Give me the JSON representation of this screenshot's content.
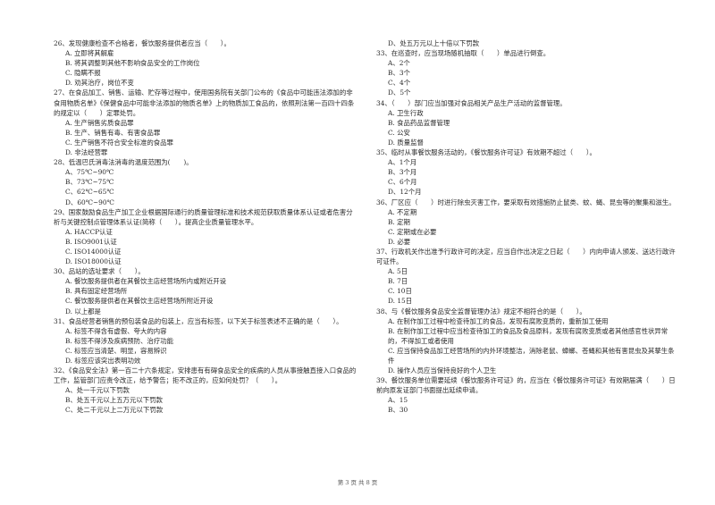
{
  "page": {
    "footer": "第 3 页 共 8 页"
  },
  "left_column": [
    {
      "stem": "26、发现健康检查不合格者，餐饮服务提供者应当（　　）。",
      "options": [
        "A. 立即将其解雇",
        "B. 将其调整到其他不影响食品安全的工作岗位",
        "C. 隐瞒不报",
        "D. 劝其治疗，岗位不变"
      ]
    },
    {
      "stem": "27、在食品加工、销售、运输、贮存等过程中，使用国务院有关部门公布的《食品中可能违法添加的非食用物质名单》《保健食品中可能非法添加的物质名单》上的物质加工食品的，依照刑法第一百四十四条的规定以（　　）定罪处罚。",
      "options": [
        "A. 生产销售劣质食品罪",
        "B. 生产、销售有毒、有害食品罪",
        "C. 生产销售不符合安全标准的食品罪",
        "D. 非法经营罪"
      ]
    },
    {
      "stem": "28、低温巴氏消毒法消毒的温度范围为(　　)。",
      "options": [
        "A、75℃~90℃",
        "B、73℃~75℃",
        "C、62℃~65℃",
        "D、60℃~90℃"
      ]
    },
    {
      "stem": "29、国家鼓励食品生产加工企业根据国际通行的质量管理标准和技术规范获取质量体系认证或者危害分析与关键控制点管理体系认证(简称（　　）。提高企业质量管理水平。",
      "options": [
        "A. HACCP认证",
        "B. ISO9001认证",
        "C. ISO14000认证",
        "D. ISO18000认证"
      ]
    },
    {
      "stem": "30、品站的选址要求（　　）。",
      "options": [
        "A. 餐饮服务提供者在其餐饮主店经营场所内或附近开设",
        "B. 具有固定经营场所",
        "C. 餐饮服务提供者在其餐饮主店经营场所附近开设",
        "D. 以上都是"
      ]
    },
    {
      "stem": "31、食品经营者销售的预包装食品的包装上，应当有标签，以下关于标签表述不正确的是（　　）。",
      "options": [
        "A. 标签不得含有虚假、夸大的内容",
        "B. 标签不得涉及疾病预防、治疗功能",
        "C. 标签应当清楚、明显，容易辨识",
        "D. 标签应该突出表明功效"
      ]
    },
    {
      "stem": "32、《食品安全法》第一百二十六条规定，安排患有有碍食品安全的疾病的人员从事接触直接入口食品的工作，监管部门应责令改正，给予警告；拒不改正的，应如何处罚？（　　）。",
      "options": [
        "A、处一千元以下罚款",
        "B、处五千元以上五万元以下罚款",
        "C、处二千元以上二万元以下罚款"
      ]
    }
  ],
  "right_column": [
    {
      "stem": "",
      "options": [
        "D、处五万元以上十倍以下罚款"
      ]
    },
    {
      "stem": "33、在巡查时，应当现场随机抽取（　　）单品进行倒查。",
      "options": [
        "A、2个",
        "B、3个",
        "C、4个",
        "D、5个"
      ]
    },
    {
      "stem": "34、（　　）部门应当加强对食品相关产品生产活动的监督管理。",
      "options": [
        "A. 卫生行政",
        "B. 食品药品监督管理",
        "C. 公安",
        "D. 质量监督"
      ]
    },
    {
      "stem": "35、临时从事餐饮服务活动的，《餐饮服务许可证》有效期不超过（　　）。",
      "options": [
        "A、1个月",
        "B、3个月",
        "C、6个月",
        "D、12个月"
      ]
    },
    {
      "stem": "36、厂区应（　　）时进行除虫灭害工作，要采取有效措施防止鼠类、蚊、蝇、昆虫等的聚集和滋生。",
      "options": [
        "A. 不定期",
        "B. 定期",
        "C. 定期或在必要",
        "D. 必要"
      ]
    },
    {
      "stem": "37、行政机关作出准予行政许可的决定，应当自作出决定之日起（　　）内向申请人颁发、送达行政许可证件。",
      "options": [
        "A. 5日",
        "B. 7日",
        "C. 10日",
        "D. 15日"
      ]
    },
    {
      "stem": "38、与《餐饮服务食品安全监督管理办法》规定不相符合的是（　　）。",
      "options": [
        "A. 在制作加工过程中检查待加工的食品，发现有腐败变质的，重新加工使用",
        "B. 在制作加工过程中应当检查待加工的食品及食品原料，发现有腐败变质或者其他感官性状异常的，不得加工或者使用",
        "C. 应当保持食品加工经营场所的内外环境整洁，消除老鼠、蟑螂、苍蝇和其他有害昆虫及其孳生条件",
        "D. 操作人员应当保持良好的个人卫生"
      ]
    },
    {
      "stem": "39、餐饮服务单位需要延续《餐饮服务许可证》的，应当在《餐饮服务许可证》有效期届满（　　）日前向原发证部门书面提出延续申请。",
      "options": [
        "A、15",
        "B、30"
      ]
    }
  ]
}
